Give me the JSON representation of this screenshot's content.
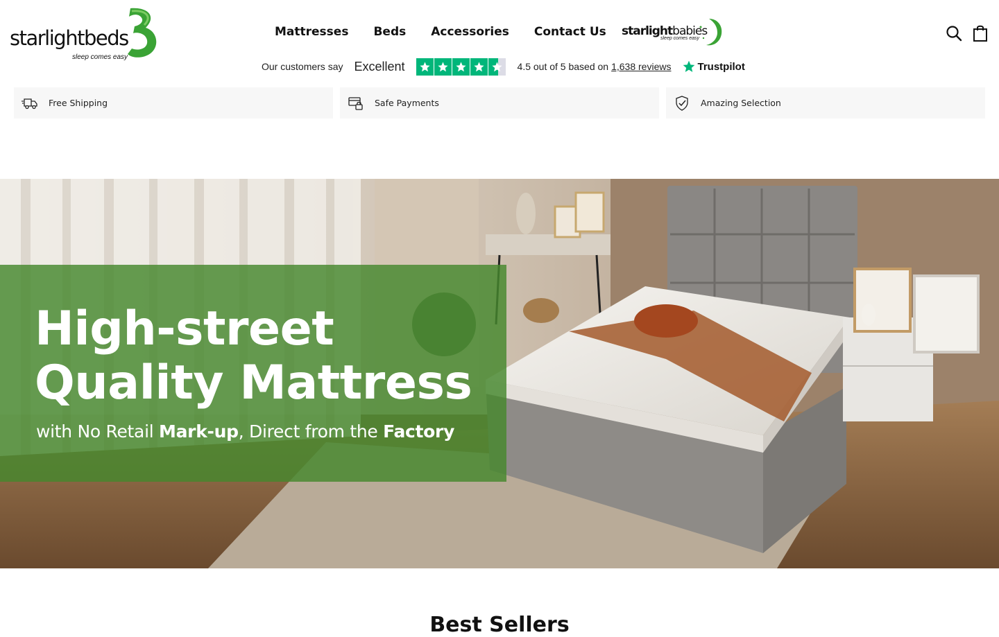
{
  "header": {
    "logo": {
      "brand_light": "starlight",
      "brand_bold": "beds",
      "tagline": "sleep comes easy",
      "colors": {
        "mark": "#3aa335",
        "text": "#111111"
      }
    },
    "nav": [
      {
        "label": "Mattresses"
      },
      {
        "label": "Beds"
      },
      {
        "label": "Accessories"
      },
      {
        "label": "Contact Us"
      }
    ],
    "babies_link": {
      "brand_light": "starlight",
      "brand_bold": "babies",
      "tagline": "sleep comes easy"
    },
    "icons": {
      "search": "search-icon",
      "cart": "shopping-bag-icon"
    }
  },
  "trustpilot": {
    "intro": "Our customers say",
    "rating_word": "Excellent",
    "stars": 4.5,
    "score_text": "4.5 out of 5 based on",
    "reviews_link": "1,638 reviews",
    "brand": "Trustpilot",
    "star_color": "#00b67a"
  },
  "features": [
    {
      "icon": "truck-icon",
      "label": "Free Shipping"
    },
    {
      "icon": "card-lock-icon",
      "label": "Safe Payments"
    },
    {
      "icon": "shield-check-icon",
      "label": "Amazing Selection"
    }
  ],
  "hero": {
    "title_line1": "High-street",
    "title_line2": "Quality Mattress",
    "sub_part1": "with No Retail ",
    "sub_bold1": "Mark-up",
    "sub_part2": ", Direct from the ",
    "sub_bold2": "Factory",
    "panel_color": "#46872d"
  },
  "next_section": {
    "heading": "Best Sellers"
  }
}
